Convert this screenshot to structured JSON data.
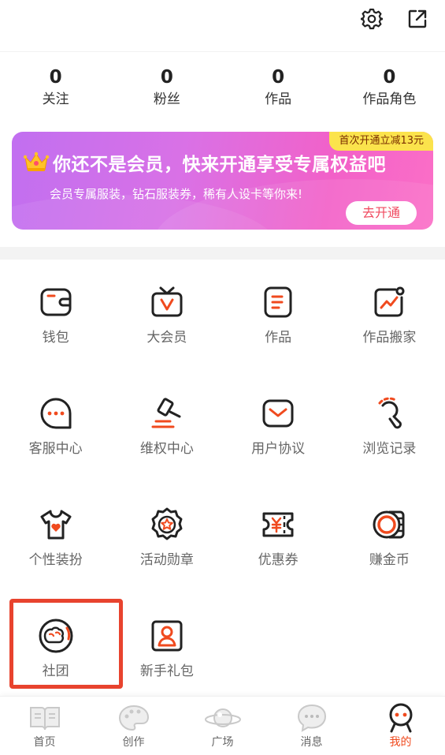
{
  "stats": [
    {
      "value": "0",
      "label": "关注"
    },
    {
      "value": "0",
      "label": "粉丝"
    },
    {
      "value": "0",
      "label": "作品"
    },
    {
      "value": "0",
      "label": "作品角色"
    }
  ],
  "vip_banner": {
    "badge": "首次开通立减13元",
    "headline": "你还不是会员，快来开通享受专属权益吧",
    "description": "会员专属服装，钻石服装券，稀有人设卡等你来!",
    "button": "去开通"
  },
  "menu": [
    {
      "label": "钱包",
      "icon": "wallet-icon"
    },
    {
      "label": "大会员",
      "icon": "vip-icon"
    },
    {
      "label": "作品",
      "icon": "works-icon"
    },
    {
      "label": "作品搬家",
      "icon": "move-works-icon"
    },
    {
      "label": "客服中心",
      "icon": "chat-icon"
    },
    {
      "label": "维权中心",
      "icon": "gavel-icon"
    },
    {
      "label": "用户协议",
      "icon": "mail-icon"
    },
    {
      "label": "浏览记录",
      "icon": "history-icon"
    },
    {
      "label": "个性装扮",
      "icon": "tshirt-icon"
    },
    {
      "label": "活动勋章",
      "icon": "medal-icon"
    },
    {
      "label": "优惠券",
      "icon": "coupon-icon"
    },
    {
      "label": "赚金币",
      "icon": "coins-icon"
    },
    {
      "label": "社团",
      "icon": "club-icon"
    },
    {
      "label": "新手礼包",
      "icon": "profile-card-icon"
    }
  ],
  "tabs": [
    {
      "label": "首页",
      "icon": "book-icon"
    },
    {
      "label": "创作",
      "icon": "palette-icon"
    },
    {
      "label": "广场",
      "icon": "planet-icon"
    },
    {
      "label": "消息",
      "icon": "message-icon"
    },
    {
      "label": "我的",
      "icon": "person-icon",
      "active": true
    }
  ],
  "colors": {
    "accent": "#f04a1e",
    "highlight_box": "#e8432e",
    "vip_gradient_start": "#c16ff0",
    "vip_gradient_end": "#fb6fc7",
    "badge_bg": "#fbe34c"
  }
}
